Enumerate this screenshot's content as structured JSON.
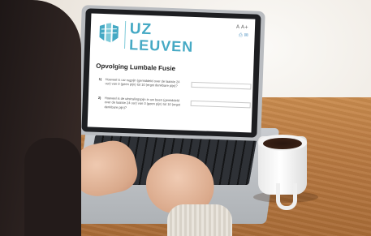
{
  "screen": {
    "brand": {
      "line1": "UZ",
      "line2": "LEUVEN",
      "accent": "#45a9c4"
    },
    "font_controls": "A A+",
    "page_title": "Opvolging Lumbale Fusie",
    "questions": [
      {
        "number": "1)",
        "text": "Hoeveel is uw rugpijn (gemiddeld over de laatste 24 uur) van 0 (geen pijn) tot 10 (ergst denkbare pijn)?"
      },
      {
        "number": "2)",
        "text": "Hoeveel is de uitstralingspijn in uw been (gemiddeld over de laatste 24 uur) van 0 (geen pijn) tot 10 (ergst denkbare pijn)?"
      }
    ]
  },
  "icons": {
    "logo": "uz-leuven-logo-icon",
    "print": "print-icon",
    "mail": "mail-icon"
  }
}
